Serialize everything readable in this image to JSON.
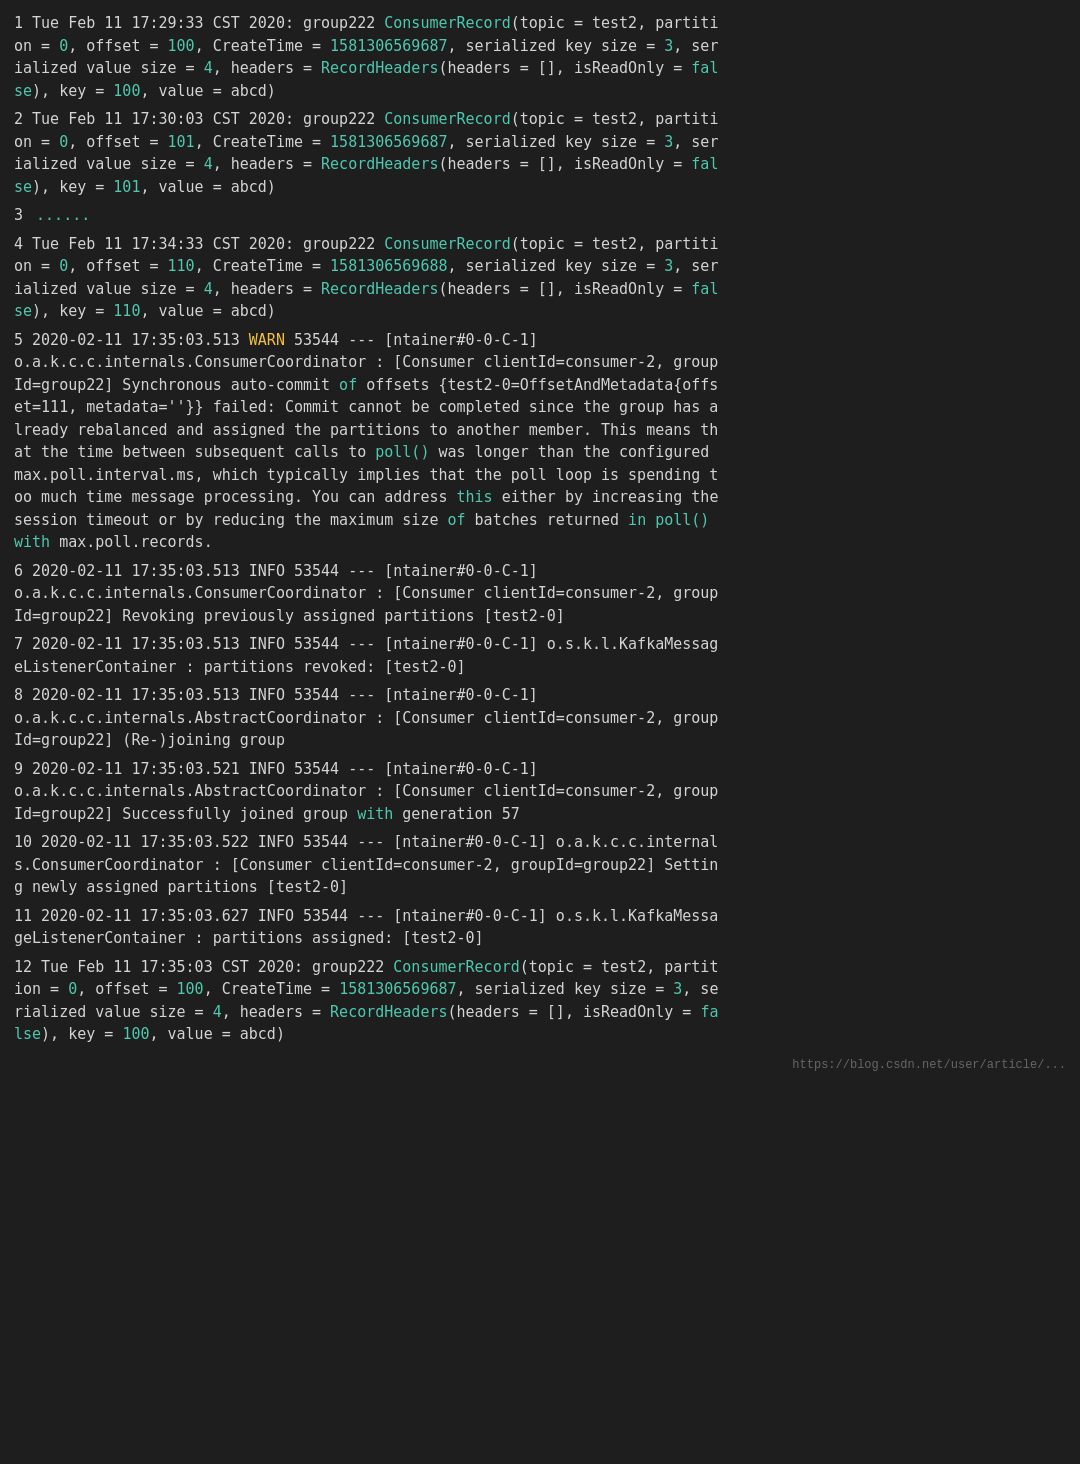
{
  "logs": [
    {
      "id": "1",
      "prefix": "1 Tue Feb 11 17:29:33 CST 2020: group222 ",
      "classname": "ConsumerRecord",
      "params": "(topic = test2, partition = 0, offset = 100, CreateTime = 1581306569687, serialized key size = 3, serialized value size = 4, headers = ",
      "recordheaders": "RecordHeaders",
      "params2": "(headers = [], isReadOnly = false), key = 100, value = abcd)"
    },
    {
      "id": "2",
      "prefix": "2 Tue Feb 11 17:30:03 CST 2020: group222 ",
      "classname": "ConsumerRecord",
      "params": "(topic = test2, partition = 0, offset = 101, CreateTime = 1581306569687, serialized key size = 3, serialized value size = 4, headers = ",
      "recordheaders": "RecordHeaders",
      "params2": "(headers = [], isReadOnly = false), key = 101, value = abcd)"
    },
    {
      "id": "3",
      "ellipsis": "......"
    },
    {
      "id": "4",
      "prefix": "4 Tue Feb 11 17:34:33 CST 2020: group222 ",
      "classname": "ConsumerRecord",
      "params": "(topic = test2, partition = 0, offset = 110, CreateTime = 1581306569688, serialized key size = 3, serialized value size = 4, headers = ",
      "recordheaders": "RecordHeaders",
      "params2": "(headers = [], isReadOnly = false), key = 110, value = abcd)"
    },
    {
      "id": "5",
      "header": "5 2020-02-11 17:35:03.513 WARN 53544 --- [ntainer#0-0-C-1]",
      "level": "WARN",
      "body": "o.a.k.c.c.internals.ConsumerCoordinator : [Consumer clientId=consumer-2, groupId=group22] Synchronous auto-commit ",
      "of1": "of",
      "body2": " offsets {test2-0=OffsetAndMetadata{offset=111, metadata=''}} failed: Commit cannot be completed since the group has already rebalanced and assigned the partitions to another member. This means that the time between subsequent calls to ",
      "poll1": "poll()",
      "body3": " was longer than the configured max.poll.interval.ms, which typically implies that the poll loop is spending too much time message processing. You can address ",
      "this1": "this",
      "body4": " either by increasing the session timeout or by reducing the maximum size ",
      "of2": "of",
      "body5": " batches returned ",
      "in1": "in",
      "poll2": "poll()",
      "body6": "\n",
      "with1": "with",
      "body7": " max.poll.records."
    },
    {
      "id": "6",
      "header": "6 2020-02-11 17:35:03.513 INFO 53544 --- [ntainer#0-0-C-1]",
      "level": "INFO",
      "body": "o.a.k.c.c.internals.ConsumerCoordinator : [Consumer clientId=consumer-2, groupId=group22] Revoking previously assigned partitions [test2-0]"
    },
    {
      "id": "7",
      "header": "7 2020-02-11 17:35:03.513 INFO 53544 --- [ntainer#0-0-C-1]",
      "level": "INFO",
      "body": "o.s.k.l.KafkaMessageListenerContainer : partitions revoked: [test2-0]"
    },
    {
      "id": "8",
      "header": "8 2020-02-11 17:35:03.513 INFO 53544 --- [ntainer#0-0-C-1]",
      "level": "INFO",
      "body": "o.a.k.c.c.internals.AbstractCoordinator : [Consumer clientId=consumer-2, groupId=group22] (Re-)joining group"
    },
    {
      "id": "9",
      "header": "9 2020-02-11 17:35:03.521 INFO 53544 --- [ntainer#0-0-C-1]",
      "level": "INFO",
      "body": "o.a.k.c.c.internals.AbstractCoordinator : [Consumer clientId=consumer-2, groupId=group22] Successfully joined group ",
      "with2": "with",
      "body2": " generation 57"
    },
    {
      "id": "10",
      "header": "10 2020-02-11 17:35:03.522 INFO 53544 --- [ntainer#0-0-C-1]",
      "level": "INFO",
      "body": "o.a.k.c.c.internals.ConsumerCoordinator : [Consumer clientId=consumer-2, groupId=group22] Setting newly assigned partitions [test2-0]"
    },
    {
      "id": "11",
      "header": "11 2020-02-11 17:35:03.627 INFO 53544 --- [ntainer#0-0-C-1]",
      "level": "INFO",
      "body": "o.s.k.l.KafkaMessageListenerContainer : partitions assigned: [test2-0]"
    },
    {
      "id": "12",
      "prefix": "12 Tue Feb 11 17:35:03 CST 2020: group222 ",
      "classname": "ConsumerRecord",
      "params": "(topic = test2, partition = 0, offset = 100, CreateTime = 1581306569687, serialized key size = 3, serialized value size = 4, headers = ",
      "recordheaders": "RecordHeaders",
      "params2": "(headers = [], isReadOnly = false), key = 100, value = abcd)"
    }
  ],
  "footer": "https://blog.csdn.net/user/article/..."
}
